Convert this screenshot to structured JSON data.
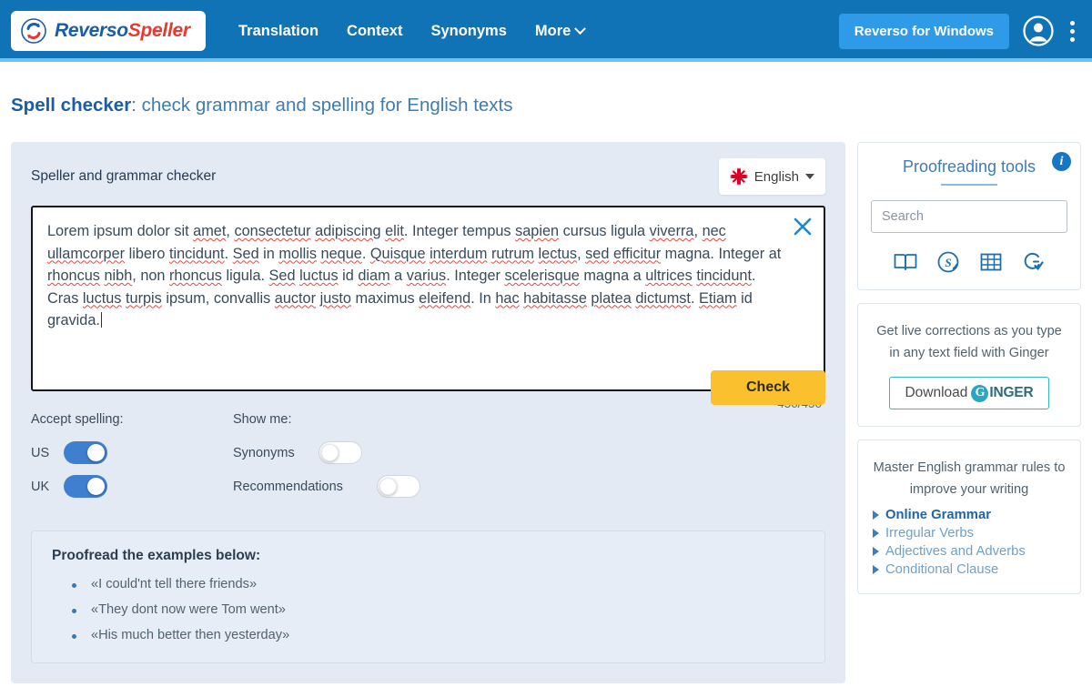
{
  "header": {
    "logo": {
      "first": "Reverso",
      "second": "Speller",
      "icon": "reverso-circle-arrows-icon"
    },
    "nav": [
      {
        "label": "Translation",
        "icon": null
      },
      {
        "label": "Context",
        "icon": null
      },
      {
        "label": "Synonyms",
        "icon": null
      },
      {
        "label": "More",
        "icon": "chevron-down-icon"
      }
    ],
    "windows_button": "Reverso for Windows",
    "account_icon": "user-avatar-icon",
    "menu_icon": "kebab-menu-icon",
    "bg_color": "#0f73b5",
    "accent_color": "#2e9ae8"
  },
  "page": {
    "title_strong": "Spell checker",
    "title_rest": ": check grammar and spelling for English texts"
  },
  "main": {
    "card_title": "Speller and grammar checker",
    "language": {
      "label": "English",
      "flag": "uk-flag-icon"
    },
    "editor": {
      "close_icon": "close-x-icon",
      "paragraph": [
        {
          "t": "Lorem ipsum dolor sit ",
          "sp": false
        },
        {
          "t": "amet",
          "sp": true
        },
        {
          "t": ", ",
          "sp": false
        },
        {
          "t": "consectetur",
          "sp": true
        },
        {
          "t": " ",
          "sp": false
        },
        {
          "t": "adipiscing",
          "sp": true
        },
        {
          "t": " ",
          "sp": false
        },
        {
          "t": "elit",
          "sp": true
        },
        {
          "t": ". Integer tempus ",
          "sp": false
        },
        {
          "t": "sapien",
          "sp": true
        },
        {
          "t": " cursus ligula ",
          "sp": false
        },
        {
          "t": "viverra",
          "sp": true
        },
        {
          "t": ", ",
          "sp": false
        },
        {
          "t": "nec",
          "sp": true
        },
        {
          "t": " ",
          "sp": false
        },
        {
          "t": "ullamcorper",
          "sp": true
        },
        {
          "t": " libero ",
          "sp": false
        },
        {
          "t": "tincidunt",
          "sp": true
        },
        {
          "t": ". ",
          "sp": false
        },
        {
          "t": "Sed",
          "sp": true
        },
        {
          "t": " in ",
          "sp": false
        },
        {
          "t": "mollis",
          "sp": true
        },
        {
          "t": " ",
          "sp": false
        },
        {
          "t": "neque",
          "sp": true
        },
        {
          "t": ". ",
          "sp": false
        },
        {
          "t": "Quisque",
          "sp": true
        },
        {
          "t": " ",
          "sp": false
        },
        {
          "t": "interdum",
          "sp": true
        },
        {
          "t": " ",
          "sp": false
        },
        {
          "t": "rutrum",
          "sp": true
        },
        {
          "t": " ",
          "sp": false
        },
        {
          "t": "lectus",
          "sp": true
        },
        {
          "t": ", ",
          "sp": false
        },
        {
          "t": "sed",
          "sp": true
        },
        {
          "t": " ",
          "sp": false
        },
        {
          "t": "efficitur",
          "sp": true
        },
        {
          "t": " magna. Integer at ",
          "sp": false
        },
        {
          "t": "rhoncus",
          "sp": true
        },
        {
          "t": " ",
          "sp": false
        },
        {
          "t": "nibh",
          "sp": true
        },
        {
          "t": ", non ",
          "sp": false
        },
        {
          "t": "rhoncus",
          "sp": true
        },
        {
          "t": " ligula. ",
          "sp": false
        },
        {
          "t": "Sed",
          "sp": true
        },
        {
          "t": " ",
          "sp": false
        },
        {
          "t": "luctus",
          "sp": true
        },
        {
          "t": " id ",
          "sp": false
        },
        {
          "t": "diam",
          "sp": true
        },
        {
          "t": " a ",
          "sp": false
        },
        {
          "t": "varius",
          "sp": true
        },
        {
          "t": ". Integer ",
          "sp": false
        },
        {
          "t": "scelerisque",
          "sp": true
        },
        {
          "t": " magna a ",
          "sp": false
        },
        {
          "t": "ultrices",
          "sp": true
        },
        {
          "t": " ",
          "sp": false
        },
        {
          "t": "tincidunt",
          "sp": true
        },
        {
          "t": ". Cras ",
          "sp": false
        },
        {
          "t": "luctus",
          "sp": true
        },
        {
          "t": " ",
          "sp": false
        },
        {
          "t": "turpis",
          "sp": true
        },
        {
          "t": " ipsum, convallis ",
          "sp": false
        },
        {
          "t": "auctor",
          "sp": true
        },
        {
          "t": " ",
          "sp": false
        },
        {
          "t": "justo",
          "sp": true
        },
        {
          "t": " maximus ",
          "sp": false
        },
        {
          "t": "eleifend",
          "sp": true
        },
        {
          "t": ". In ",
          "sp": false
        },
        {
          "t": "hac",
          "sp": true
        },
        {
          "t": " ",
          "sp": false
        },
        {
          "t": "habitasse",
          "sp": true
        },
        {
          "t": " ",
          "sp": false
        },
        {
          "t": "platea",
          "sp": true
        },
        {
          "t": " ",
          "sp": false
        },
        {
          "t": "dictumst",
          "sp": true
        },
        {
          "t": ". ",
          "sp": false
        },
        {
          "t": "Etiam",
          "sp": true
        },
        {
          "t": " id gravida.",
          "sp": false
        }
      ]
    },
    "counter": "450/450",
    "controls": {
      "accept_spelling_label": "Accept spelling:",
      "show_me_label": "Show me:",
      "us_label": "US",
      "us_on": true,
      "uk_label": "UK",
      "uk_on": true,
      "synonyms_label": "Synonyms",
      "synonyms_on": false,
      "recommendations_label": "Recommendations",
      "recommendations_on": false,
      "check_button": "Check",
      "check_color": "#fbc02d"
    },
    "examples": {
      "title": "Proofread the examples below:",
      "items": [
        "«I could'nt tell there friends»",
        "«They dont now were Tom went»",
        "«His much better then yesterday»"
      ]
    }
  },
  "sidebar": {
    "tools": {
      "title": "Proofreading tools",
      "info_icon": "info-icon",
      "info_glyph": "i",
      "search_placeholder": "Search",
      "search_value": "",
      "icons": [
        {
          "name": "dictionary-book-icon"
        },
        {
          "name": "synonyms-s-circle-icon"
        },
        {
          "name": "conjugation-grid-icon"
        },
        {
          "name": "grammar-check-icon"
        }
      ]
    },
    "ginger": {
      "text": "Get live corrections as you type in any text field with Ginger",
      "button_label": "Download",
      "brand_g": "G",
      "brand_rest": "INGER"
    },
    "grammar": {
      "intro": "Master English grammar rules to improve your writing",
      "links": [
        {
          "label": "Online Grammar",
          "strong": true
        },
        {
          "label": "Irregular Verbs",
          "strong": false
        },
        {
          "label": "Adjectives and Adverbs",
          "strong": false
        },
        {
          "label": "Conditional Clause",
          "strong": false
        }
      ]
    }
  }
}
